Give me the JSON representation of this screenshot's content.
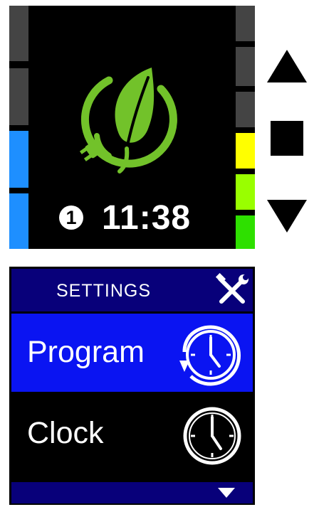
{
  "colors": {
    "leaf_green": "#72c22a",
    "header_blue": "#08007a",
    "selected_blue": "#0a14f2",
    "bar_gray": "#444444",
    "bar_blue": "#1e8fff",
    "bar_yellow": "#ffff00",
    "bar_lime": "#99ff00",
    "bar_green": "#2ee000"
  },
  "top_screen": {
    "logo_icon": "eco-leaf-plug-icon",
    "channel": "1",
    "time": "11:38"
  },
  "controls": {
    "up_icon": "triangle-up-icon",
    "stop_icon": "square-stop-icon",
    "down_icon": "triangle-down-icon"
  },
  "settings_screen": {
    "title": "SETTINGS",
    "title_icon": "wrench-screwdriver-icon",
    "items": [
      {
        "label": "Program",
        "icon": "program-clock-icon",
        "selected": true
      },
      {
        "label": "Clock",
        "icon": "clock-icon",
        "selected": false
      }
    ],
    "scroll_icon": "chevron-down-icon"
  }
}
